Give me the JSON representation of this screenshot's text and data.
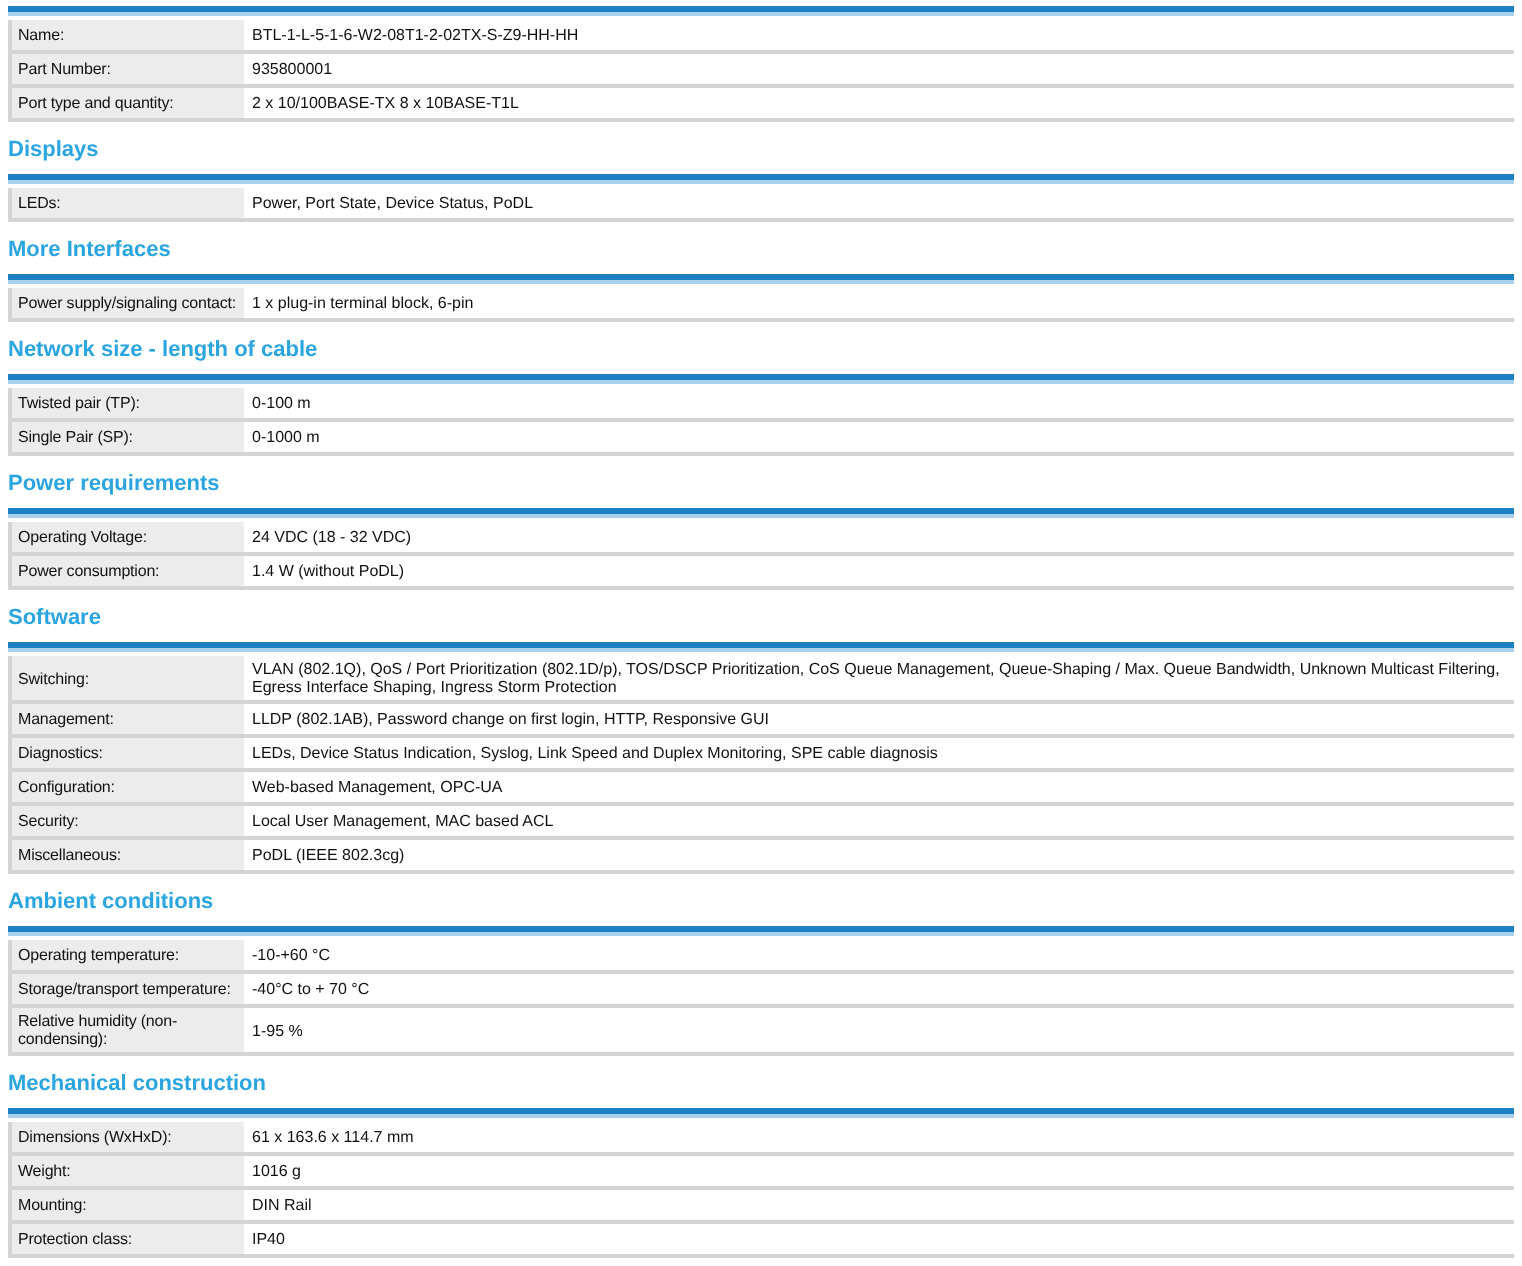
{
  "sections": [
    {
      "rows": [
        {
          "label": "Name:",
          "value": "BTL-1-L-5-1-6-W2-08T1-2-02TX-S-Z9-HH-HH"
        },
        {
          "label": "Part Number:",
          "value": "935800001"
        },
        {
          "label": "Port type and quantity:",
          "value": "2 x 10/100BASE-TX 8 x 10BASE-T1L"
        }
      ]
    },
    {
      "title": "Displays",
      "rows": [
        {
          "label": "LEDs:",
          "value": "Power, Port State, Device Status, PoDL"
        }
      ]
    },
    {
      "title": "More Interfaces",
      "rows": [
        {
          "label": "Power supply/signaling contact:",
          "value": "1 x plug-in terminal block, 6-pin"
        }
      ]
    },
    {
      "title": "Network size - length of cable",
      "rows": [
        {
          "label": "Twisted pair (TP):",
          "value": "0-100 m"
        },
        {
          "label": "Single Pair (SP):",
          "value": "0-1000 m"
        }
      ]
    },
    {
      "title": "Power requirements",
      "rows": [
        {
          "label": "Operating Voltage:",
          "value": "24 VDC (18 - 32 VDC)"
        },
        {
          "label": "Power consumption:",
          "value": "1.4 W (without PoDL)"
        }
      ]
    },
    {
      "title": "Software",
      "rows": [
        {
          "label": "Switching:",
          "value": "VLAN (802.1Q), QoS / Port Prioritization (802.1D/p), TOS/DSCP Prioritization, CoS Queue Management, Queue-Shaping / Max. Queue Bandwidth, Unknown Multicast Filtering, Egress Interface Shaping, Ingress Storm Protection"
        },
        {
          "label": "Management:",
          "value": "LLDP (802.1AB), Password change on first login, HTTP, Responsive GUI"
        },
        {
          "label": "Diagnostics:",
          "value": "LEDs, Device Status Indication, Syslog, Link Speed and Duplex Monitoring, SPE cable diagnosis"
        },
        {
          "label": "Configuration:",
          "value": "Web-based Management, OPC-UA"
        },
        {
          "label": "Security:",
          "value": "Local User Management, MAC based ACL"
        },
        {
          "label": "Miscellaneous:",
          "value": "PoDL (IEEE 802.3cg)"
        }
      ]
    },
    {
      "title": "Ambient conditions",
      "rows": [
        {
          "label": "Operating temperature:",
          "value": "-10-+60 °C"
        },
        {
          "label": "Storage/transport temperature:",
          "value": "-40°C to + 70 °C"
        },
        {
          "label": "Relative humidity (non-condensing):",
          "value": "1-95 %"
        }
      ]
    },
    {
      "title": "Mechanical construction",
      "rows": [
        {
          "label": "Dimensions (WxHxD):",
          "value": "61 x 163.6 x 114.7 mm"
        },
        {
          "label": "Weight:",
          "value": "1016 g"
        },
        {
          "label": "Mounting:",
          "value": "DIN Rail"
        },
        {
          "label": "Protection class:",
          "value": "IP40"
        }
      ]
    }
  ]
}
